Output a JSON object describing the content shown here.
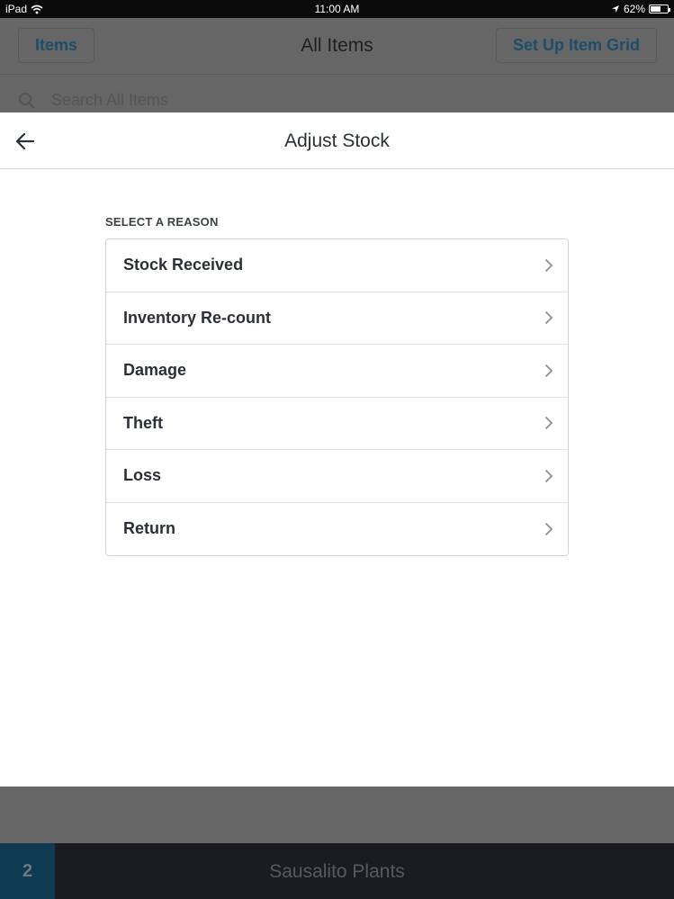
{
  "status_bar": {
    "device": "iPad",
    "time": "11:00 AM",
    "battery_percent": "62%",
    "battery_level": 0.62,
    "icons": [
      "wifi-icon",
      "location-arrow-icon",
      "battery-icon"
    ]
  },
  "background_screen": {
    "left_button": "Items",
    "title": "All Items",
    "right_button": "Set Up Item Grid",
    "search_placeholder": "Search All Items"
  },
  "modal": {
    "title": "Adjust Stock",
    "back_icon": "arrow-left-icon",
    "section_label": "SELECT A REASON",
    "reasons": [
      {
        "label": "Stock Received"
      },
      {
        "label": "Inventory Re-count"
      },
      {
        "label": "Damage"
      },
      {
        "label": "Theft"
      },
      {
        "label": "Loss"
      },
      {
        "label": "Return"
      }
    ]
  },
  "bottom_bar": {
    "badge": "2",
    "title": "Sausalito Plants"
  },
  "colors": {
    "accent": "#1d4e6a",
    "badge_bg": "#0e3a52",
    "overlay": "#666666"
  }
}
